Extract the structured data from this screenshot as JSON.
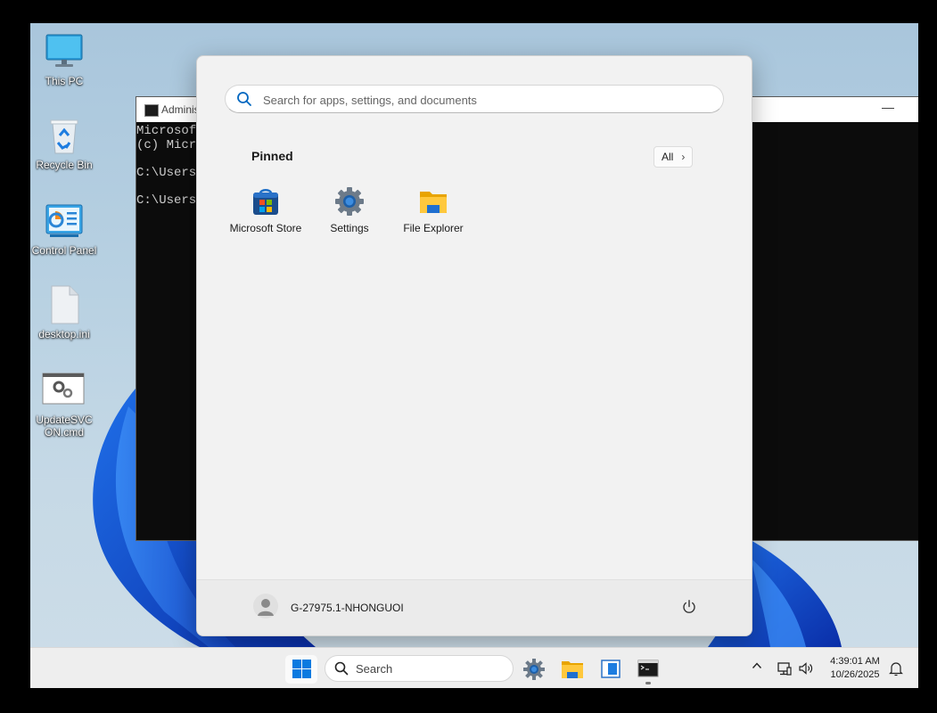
{
  "desktop": {
    "icons": [
      {
        "label": "This PC",
        "icon": "monitor-icon"
      },
      {
        "label": "Recycle Bin",
        "icon": "recycle-bin-icon"
      },
      {
        "label": "Control Panel",
        "icon": "control-panel-icon"
      },
      {
        "label": "desktop.ini",
        "icon": "file-icon"
      },
      {
        "label": "UpdateSVC",
        "label2": "ON.cmd",
        "icon": "cmd-script-icon"
      }
    ]
  },
  "cmd_window": {
    "title": "Adminis",
    "minimize_glyph": "—",
    "lines": [
      "Microsoft",
      "(c) Micro",
      "",
      "C:\\Users\\",
      "",
      "C:\\Users\\"
    ]
  },
  "start_menu": {
    "search_placeholder": "Search for apps, settings, and documents",
    "pinned_title": "Pinned",
    "all_label": "All",
    "all_chevron": "›",
    "pinned_apps": [
      {
        "label": "Microsoft Store",
        "icon": "store-icon"
      },
      {
        "label": "Settings",
        "icon": "settings-gear-icon"
      },
      {
        "label": "File Explorer",
        "icon": "folder-icon"
      }
    ],
    "user_name": "G-27975.1-NHONGUOI"
  },
  "taskbar": {
    "search_label": "Search",
    "time": "4:39:01 AM",
    "date": "10/26/2025",
    "tray_chevron": "^"
  },
  "colors": {
    "accent": "#0067c0",
    "start_bg": "#f2f2f2",
    "cmd_bg": "#0c0c0c",
    "taskbar_bg": "#eeeeee"
  }
}
